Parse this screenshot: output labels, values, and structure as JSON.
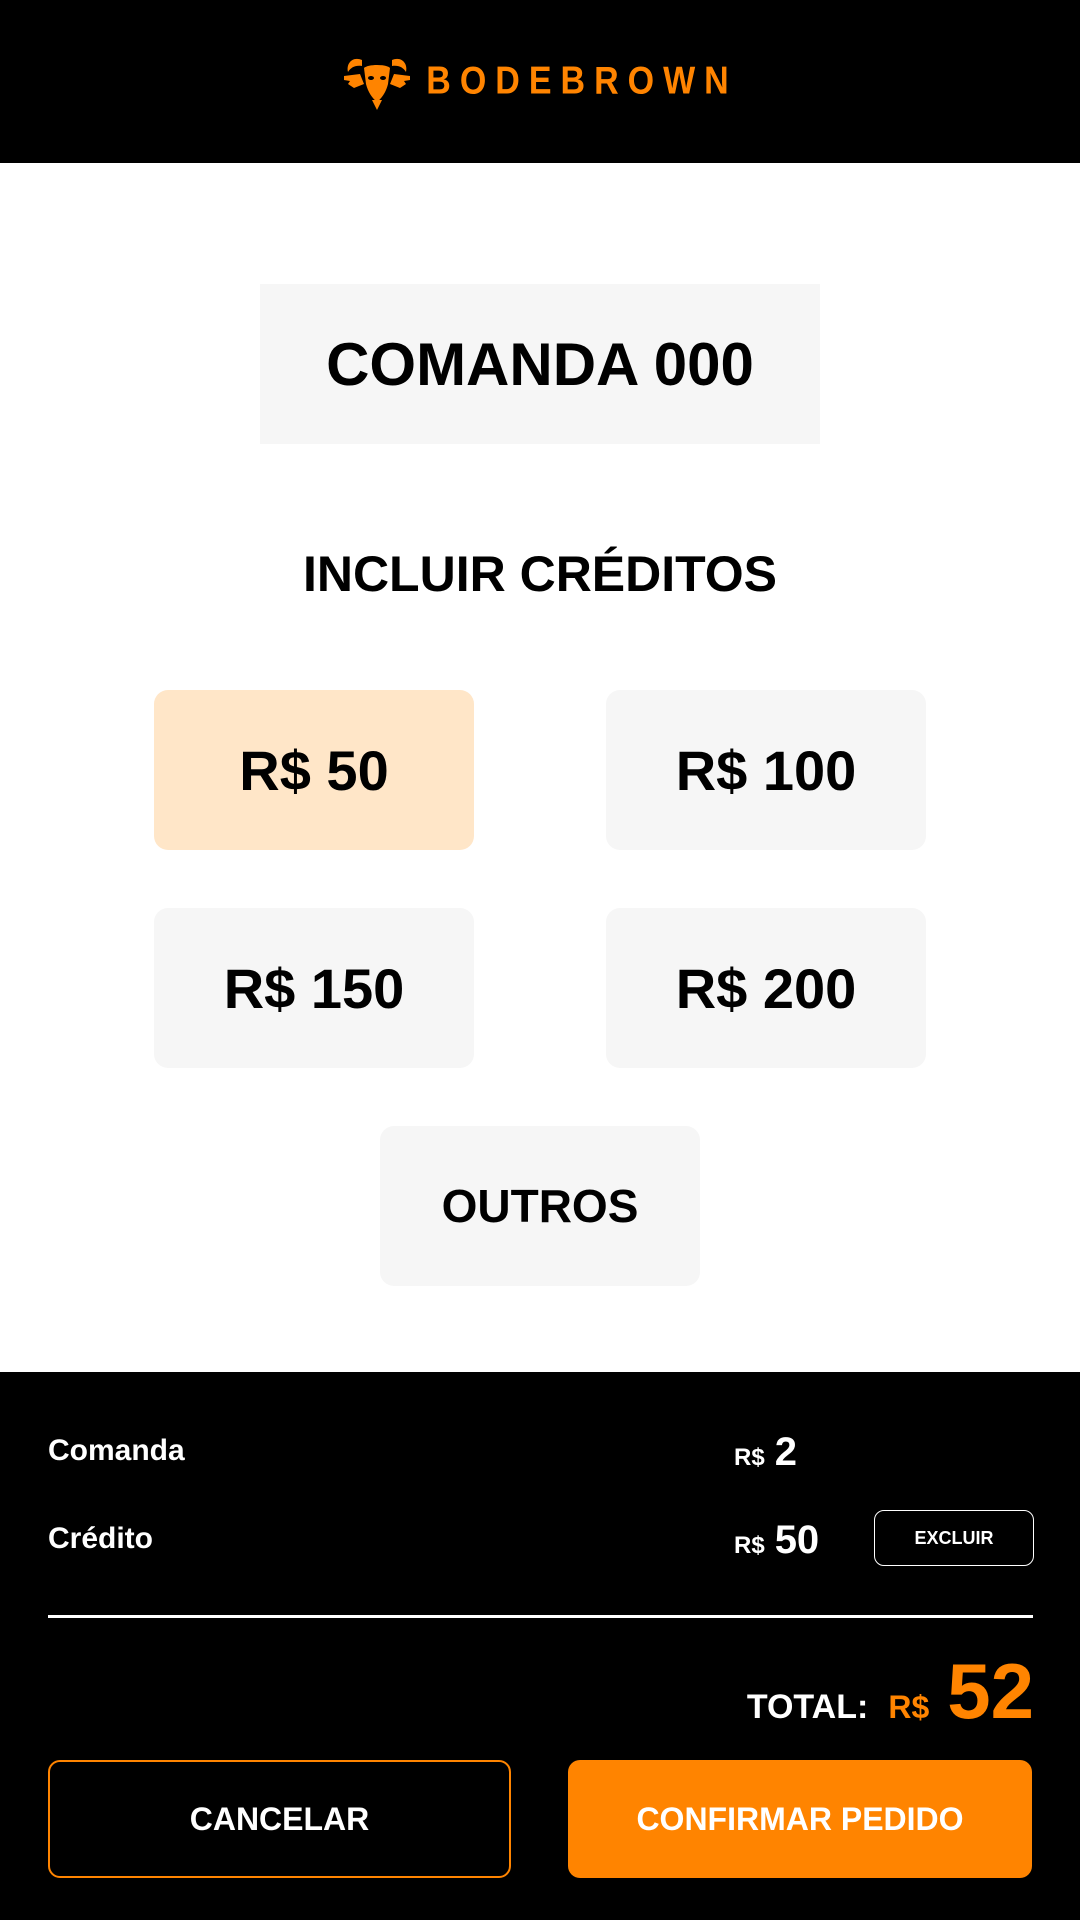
{
  "header": {
    "brand_name": "BODEBROWN",
    "logo_icon": "goat-dragon-logo-icon",
    "brand_color": "#ff8400"
  },
  "comanda": {
    "title": "COMANDA 000"
  },
  "credits": {
    "title": "INCLUIR CRÉDITOS",
    "options": [
      {
        "label": "R$ 50",
        "selected": true
      },
      {
        "label": "R$ 100",
        "selected": false
      },
      {
        "label": "R$ 150",
        "selected": false
      },
      {
        "label": "R$ 200",
        "selected": false
      },
      {
        "label": "OUTROS",
        "selected": false
      }
    ],
    "selected_color": "#ffe6c8",
    "default_color": "#f6f6f6"
  },
  "summary": {
    "rows": [
      {
        "label": "Comanda",
        "currency": "R$",
        "value": "2"
      },
      {
        "label": "Crédito",
        "currency": "R$",
        "value": "50",
        "action": "EXCLUIR"
      }
    ],
    "total_label": "TOTAL:",
    "total_currency": "R$",
    "total_value": "52",
    "cancel_label": "CANCELAR",
    "confirm_label": "CONFIRMAR PEDIDO",
    "accent_color": "#ff8400"
  }
}
